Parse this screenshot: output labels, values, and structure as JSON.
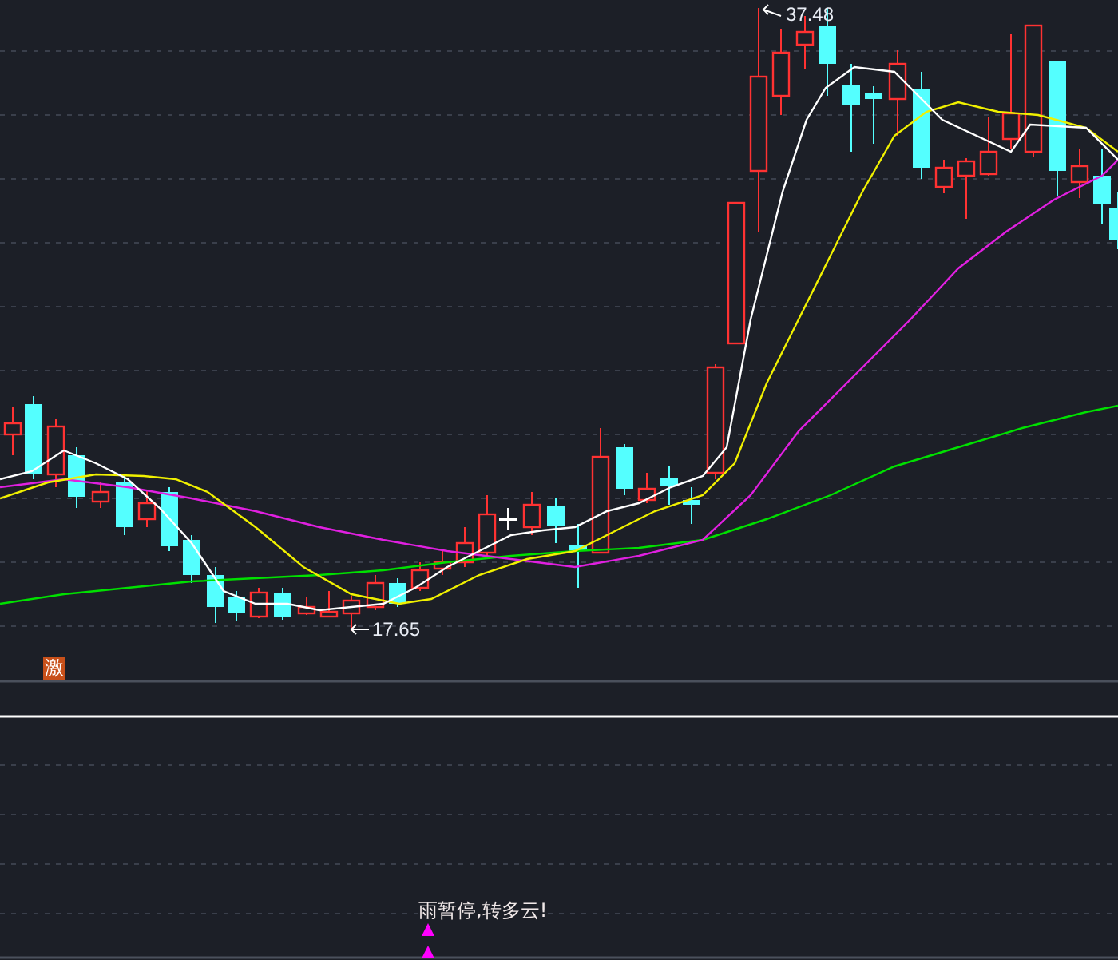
{
  "price_chart": {
    "high_label": "37.48",
    "low_label": "17.65",
    "badge": "激"
  },
  "signal_pane": {
    "signal_text": "雨暂停,转多云!"
  }
}
